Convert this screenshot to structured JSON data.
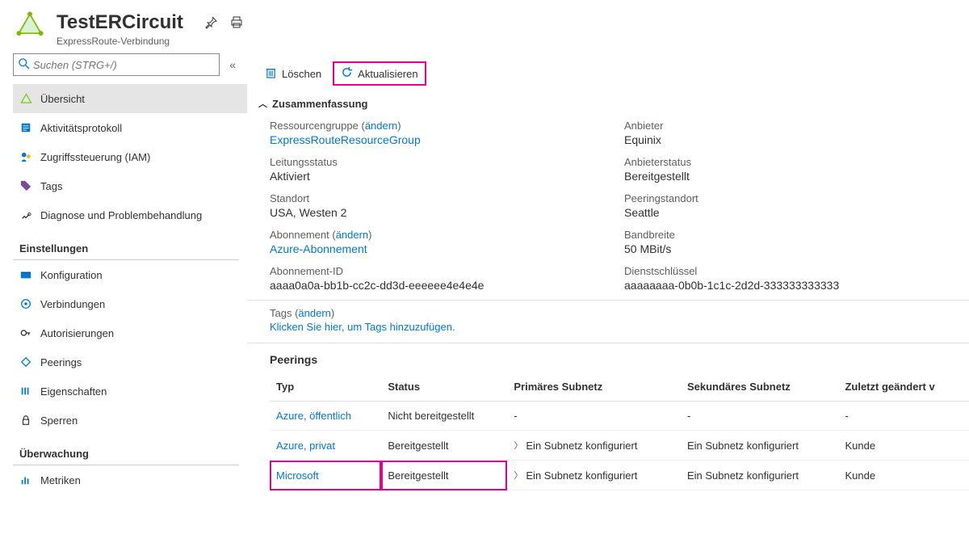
{
  "header": {
    "title": "TestERCircuit",
    "subtitle": "ExpressRoute-Verbindung"
  },
  "search": {
    "placeholder": "Suchen (STRG+/)"
  },
  "nav": {
    "items": [
      {
        "label": "Übersicht"
      },
      {
        "label": "Aktivitätsprotokoll"
      },
      {
        "label": "Zugriffssteuerung (IAM)"
      },
      {
        "label": "Tags"
      },
      {
        "label": "Diagnose und Problembehandlung"
      }
    ],
    "sections": [
      {
        "title": "Einstellungen",
        "items": [
          {
            "label": "Konfiguration"
          },
          {
            "label": "Verbindungen"
          },
          {
            "label": "Autorisierungen"
          },
          {
            "label": "Peerings"
          },
          {
            "label": "Eigenschaften"
          },
          {
            "label": "Sperren"
          }
        ]
      },
      {
        "title": "Überwachung",
        "items": [
          {
            "label": "Metriken"
          }
        ]
      }
    ]
  },
  "toolbar": {
    "delete": "Löschen",
    "refresh": "Aktualisieren"
  },
  "summary": {
    "title": "Zusammenfassung",
    "change": "ändern",
    "left": {
      "rg_label": "Ressourcengruppe",
      "rg_value": "ExpressRouteResourceGroup",
      "status_label": "Leitungsstatus",
      "status_value": "Aktiviert",
      "location_label": "Standort",
      "location_value": "USA, Westen 2",
      "sub_label": "Abonnement",
      "sub_value": "Azure-Abonnement",
      "subid_label": "Abonnement-ID",
      "subid_value": "aaaa0a0a-bb1b-cc2c-dd3d-eeeeee4e4e4e"
    },
    "right": {
      "provider_label": "Anbieter",
      "provider_value": "Equinix",
      "provstatus_label": "Anbieterstatus",
      "provstatus_value": "Bereitgestellt",
      "peerloc_label": "Peeringstandort",
      "peerloc_value": "Seattle",
      "bw_label": "Bandbreite",
      "bw_value": "50 MBit/s",
      "key_label": "Dienstschlüssel",
      "key_value": "aaaaaaaa-0b0b-1c1c-2d2d-333333333333"
    },
    "tags_label": "Tags",
    "tags_link": "Klicken Sie hier, um Tags hinzuzufügen."
  },
  "peerings": {
    "title": "Peerings",
    "columns": {
      "type": "Typ",
      "status": "Status",
      "primary": "Primäres Subnetz",
      "secondary": "Sekundäres Subnetz",
      "lastmod": "Zuletzt geändert v"
    },
    "rows": [
      {
        "type": "Azure, öffentlich",
        "status": "Nicht bereitgestellt",
        "primary": "-",
        "secondary": "-",
        "lastmod": "-",
        "chev": false
      },
      {
        "type": "Azure, privat",
        "status": "Bereitgestellt",
        "primary": "Ein Subnetz konfiguriert",
        "secondary": "Ein Subnetz konfiguriert",
        "lastmod": "Kunde",
        "chev": true
      },
      {
        "type": "Microsoft",
        "status": "Bereitgestellt",
        "primary": "Ein Subnetz konfiguriert",
        "secondary": "Ein Subnetz konfiguriert",
        "lastmod": "Kunde",
        "chev": true
      }
    ]
  }
}
